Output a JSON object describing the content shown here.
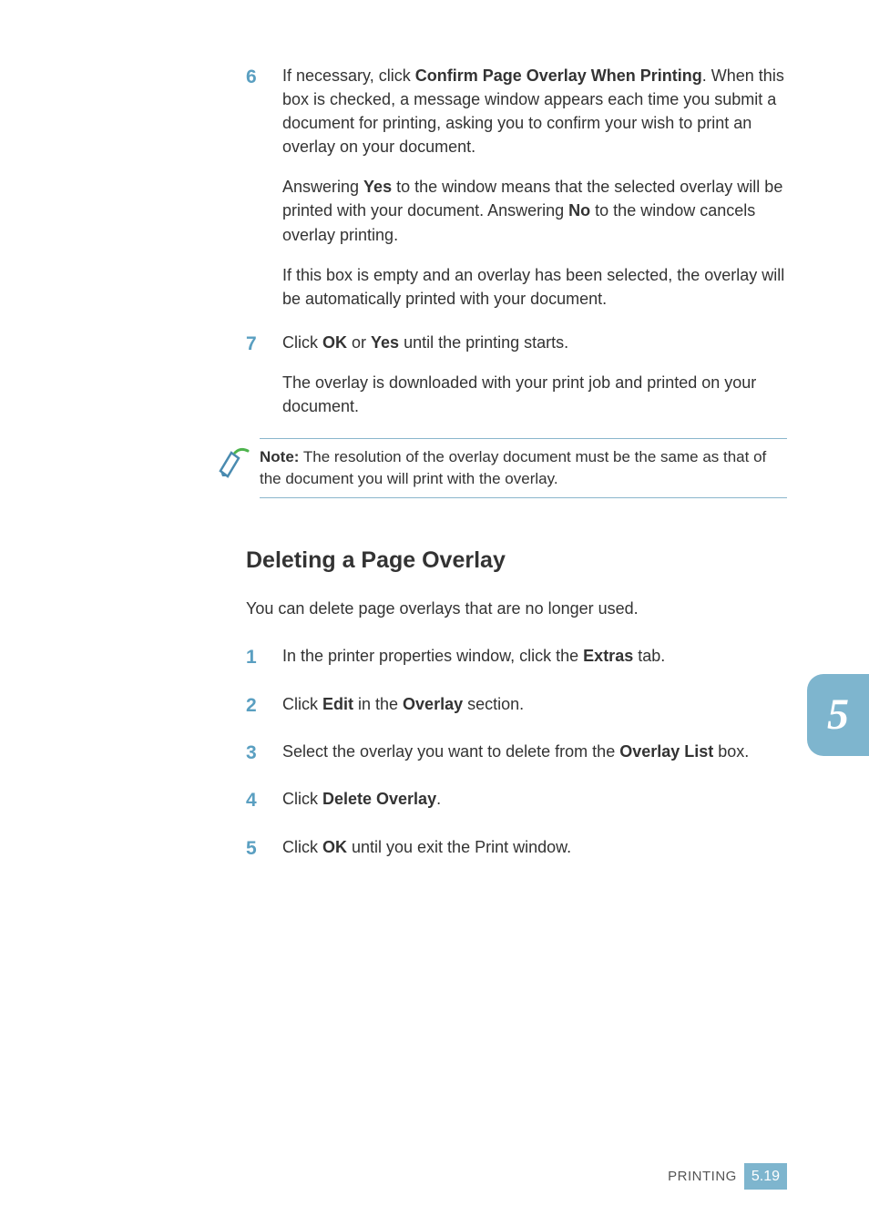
{
  "steps_a": [
    {
      "num": "6",
      "paras": [
        [
          {
            "t": "If necessary, click "
          },
          {
            "t": "Confirm Page Overlay When Printing",
            "b": true
          },
          {
            "t": ". When this box is checked, a message window appears each time you submit a document for printing, asking you to confirm your wish to print an overlay on your document."
          }
        ],
        [
          {
            "t": "Answering "
          },
          {
            "t": "Yes",
            "b": true
          },
          {
            "t": " to the window means that the selected overlay will be printed with your document. Answering "
          },
          {
            "t": "No",
            "b": true
          },
          {
            "t": " to the window cancels overlay printing."
          }
        ],
        [
          {
            "t": "If this box is empty and an overlay has been selected, the overlay will be automatically printed with your document."
          }
        ]
      ]
    },
    {
      "num": "7",
      "paras": [
        [
          {
            "t": "Click "
          },
          {
            "t": "OK",
            "b": true
          },
          {
            "t": " or "
          },
          {
            "t": "Yes",
            "b": true
          },
          {
            "t": " until the printing starts."
          }
        ],
        [
          {
            "t": "The overlay is downloaded with your print job and printed on your document."
          }
        ]
      ]
    }
  ],
  "note": {
    "label": "Note:",
    "text": " The resolution of the overlay document must be the same as that of the document you will print with the overlay."
  },
  "section_heading": "Deleting a Page Overlay",
  "intro": "You can delete page overlays that are no longer used.",
  "steps_b": [
    {
      "num": "1",
      "paras": [
        [
          {
            "t": "In the printer properties window, click the "
          },
          {
            "t": "Extras",
            "b": true
          },
          {
            "t": " tab."
          }
        ]
      ]
    },
    {
      "num": "2",
      "paras": [
        [
          {
            "t": "Click "
          },
          {
            "t": "Edit",
            "b": true
          },
          {
            "t": " in the "
          },
          {
            "t": "Overlay",
            "b": true
          },
          {
            "t": " section."
          }
        ]
      ]
    },
    {
      "num": "3",
      "paras": [
        [
          {
            "t": "Select the overlay you want to delete from the "
          },
          {
            "t": "Overlay List",
            "b": true
          },
          {
            "t": " box."
          }
        ]
      ]
    },
    {
      "num": "4",
      "paras": [
        [
          {
            "t": "Click "
          },
          {
            "t": "Delete Overlay",
            "b": true
          },
          {
            "t": "."
          }
        ]
      ]
    },
    {
      "num": "5",
      "paras": [
        [
          {
            "t": "Click "
          },
          {
            "t": "OK",
            "b": true
          },
          {
            "t": " until you exit the Print window."
          }
        ]
      ]
    }
  ],
  "chapter_tab": "5",
  "footer": {
    "label": "PRINTING",
    "chapter": "5",
    "page": "19"
  }
}
